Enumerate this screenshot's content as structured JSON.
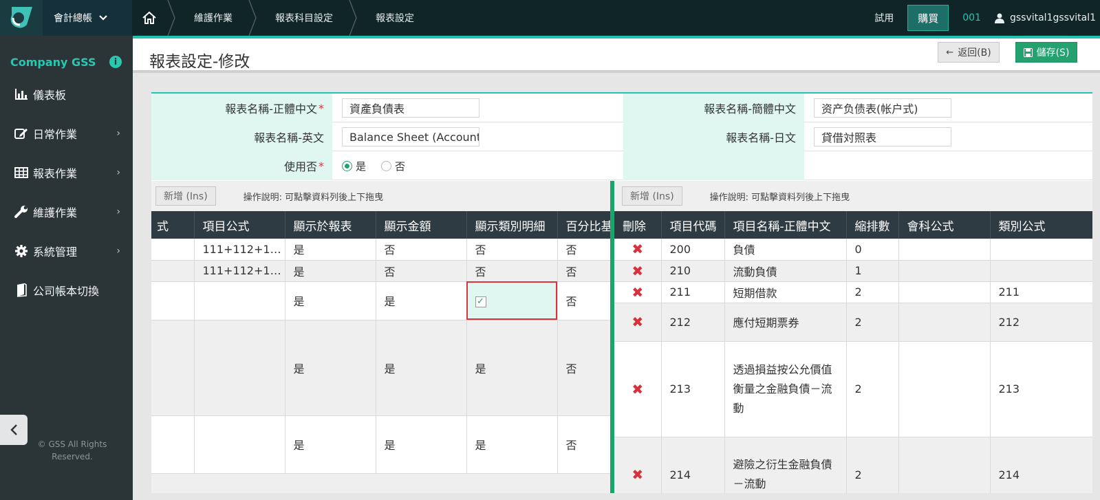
{
  "topbar": {
    "company_menu": "會計總帳",
    "breadcrumbs": [
      "維護作業",
      "報表科目設定",
      "報表設定"
    ],
    "trial": "試用",
    "buy": "購買",
    "account_code": "001",
    "user": "gssvital1gssvital1"
  },
  "sidebar": {
    "company": "Company GSS",
    "items": [
      {
        "label": "儀表板",
        "icon": "chart-icon"
      },
      {
        "label": "日常作業",
        "icon": "edit-icon"
      },
      {
        "label": "報表作業",
        "icon": "table-icon"
      },
      {
        "label": "維護作業",
        "icon": "wrench-icon"
      },
      {
        "label": "系統管理",
        "icon": "gear-icon"
      },
      {
        "label": "公司帳本切換",
        "icon": "book-icon"
      }
    ],
    "copyright_1": "© GSS All Rights",
    "copyright_2": "Reserved."
  },
  "header": {
    "title": "報表設定-修改",
    "back_label": "返回(B)",
    "save_label": "儲存(S)"
  },
  "form": {
    "name_tc_label": "報表名稱-正體中文",
    "name_tc_value": "資產負債表",
    "name_sc_label": "報表名稱-簡體中文",
    "name_sc_value": "资产负债表(帐户式)",
    "name_en_label": "報表名稱-英文",
    "name_en_value": "Balance Sheet (Account",
    "name_jp_label": "報表名稱-日文",
    "name_jp_value": "貸借対照表",
    "enabled_label": "使用否",
    "yes": "是",
    "no": "否"
  },
  "left_grid": {
    "add_label": "新增 (Ins)",
    "hint": "操作說明: 可點擊資料列後上下拖曳",
    "headers": [
      "式",
      "項目公式",
      "顯示於報表",
      "顯示金額",
      "顯示類別明細",
      "百分比基"
    ],
    "rows": [
      [
        "",
        "111+112+1…",
        "是",
        "否",
        "否",
        "否"
      ],
      [
        "",
        "111+112+1…",
        "是",
        "否",
        "否",
        "否"
      ],
      [
        "",
        "",
        "是",
        "是",
        "",
        "否"
      ],
      [
        "",
        "",
        "是",
        "是",
        "是",
        "否"
      ],
      [
        "",
        "",
        "是",
        "是",
        "是",
        "否"
      ]
    ]
  },
  "right_grid": {
    "add_label": "新增 (Ins)",
    "hint": "操作說明: 可點擊資料列後上下拖曳",
    "headers": [
      "刪除",
      "項目代碼",
      "項目名稱-正體中文",
      "縮排數",
      "會科公式",
      "類別公式"
    ],
    "rows": [
      [
        "200",
        "負債",
        "0",
        "",
        ""
      ],
      [
        "210",
        "流動負債",
        "1",
        "",
        ""
      ],
      [
        "211",
        "短期借款",
        "2",
        "",
        "211"
      ],
      [
        "212",
        "應付短期票券",
        "2",
        "",
        "212"
      ],
      [
        "213",
        "透過損益按公允價值衡量之金融負債－流動",
        "2",
        "",
        "213"
      ],
      [
        "214",
        "避險之衍生金融負債－流動",
        "2",
        "",
        "214"
      ]
    ]
  },
  "colors": {
    "accent": "#1fc3b0",
    "save": "#23a26f",
    "delete": "#d8313a",
    "header_bg": "#2e3b42"
  }
}
